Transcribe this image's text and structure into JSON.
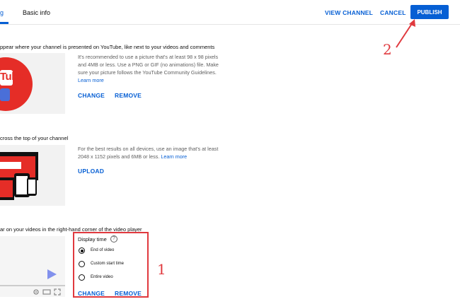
{
  "tabs": {
    "partial": "g",
    "basic_info": "Basic info"
  },
  "header": {
    "view_channel": "VIEW CHANNEL",
    "cancel": "CANCEL",
    "publish": "PUBLISH"
  },
  "picture": {
    "title": "ppear where your channel is presented on YouTube, like next to your videos and comments",
    "thumb_text": "Tube",
    "desc": "It's recommended to use a picture that's at least 98 x 98 pixels and 4MB or less. Use a PNG or GIF (no animations) file. Make sure your picture follows the YouTube Community Guidelines.",
    "learn_more": "Learn more",
    "change": "CHANGE",
    "remove": "REMOVE"
  },
  "banner": {
    "title": "cross the top of your channel",
    "desc": "For the best results on all devices, use an image that's at least 2048 x 1152 pixels and 6MB or less.",
    "learn_more": "Learn more",
    "upload": "UPLOAD"
  },
  "watermark": {
    "title": "ar on your videos in the right-hand corner of the video player",
    "display_time_label": "Display time",
    "help_glyph": "?",
    "options": [
      "End of video",
      "Custom start time",
      "Entire video"
    ],
    "selected_option": "End of video",
    "change": "CHANGE",
    "remove": "REMOVE"
  },
  "annotations": {
    "step1": "1",
    "step2": "2"
  },
  "colors": {
    "accent": "#065fd4",
    "youtube_red": "#e52d27",
    "annotation_red": "#e0393e"
  }
}
